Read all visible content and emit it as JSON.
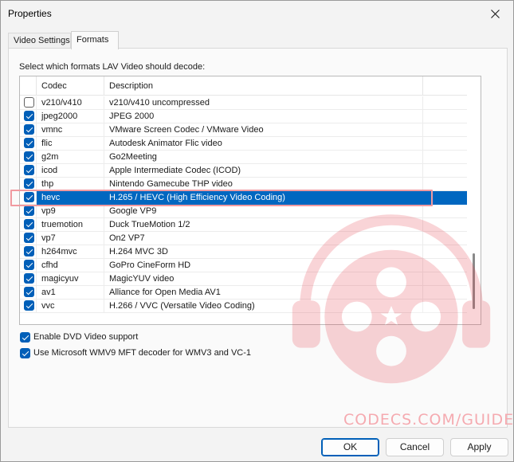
{
  "window": {
    "title": "Properties"
  },
  "tabs": [
    {
      "label": "Video Settings",
      "active": false
    },
    {
      "label": "Formats",
      "active": true
    }
  ],
  "formats": {
    "instruction": "Select which formats LAV Video should decode:",
    "columns": {
      "codec": "Codec",
      "description": "Description"
    },
    "rows": [
      {
        "codec": "v210/v410",
        "description": "v210/v410 uncompressed",
        "checked": false,
        "selected": false
      },
      {
        "codec": "jpeg2000",
        "description": "JPEG 2000",
        "checked": true,
        "selected": false
      },
      {
        "codec": "vmnc",
        "description": "VMware Screen Codec / VMware Video",
        "checked": true,
        "selected": false
      },
      {
        "codec": "flic",
        "description": "Autodesk Animator Flic video",
        "checked": true,
        "selected": false
      },
      {
        "codec": "g2m",
        "description": "Go2Meeting",
        "checked": true,
        "selected": false
      },
      {
        "codec": "icod",
        "description": "Apple Intermediate Codec (ICOD)",
        "checked": true,
        "selected": false
      },
      {
        "codec": "thp",
        "description": "Nintendo Gamecube THP video",
        "checked": true,
        "selected": false
      },
      {
        "codec": "hevc",
        "description": "H.265 / HEVC (High Efficiency Video Coding)",
        "checked": true,
        "selected": true
      },
      {
        "codec": "vp9",
        "description": "Google VP9",
        "checked": true,
        "selected": false
      },
      {
        "codec": "truemotion",
        "description": "Duck TrueMotion 1/2",
        "checked": true,
        "selected": false
      },
      {
        "codec": "vp7",
        "description": "On2 VP7",
        "checked": true,
        "selected": false
      },
      {
        "codec": "h264mvc",
        "description": "H.264 MVC 3D",
        "checked": true,
        "selected": false
      },
      {
        "codec": "cfhd",
        "description": "GoPro CineForm HD",
        "checked": true,
        "selected": false
      },
      {
        "codec": "magicyuv",
        "description": "MagicYUV video",
        "checked": true,
        "selected": false
      },
      {
        "codec": "av1",
        "description": "Alliance for Open Media AV1",
        "checked": true,
        "selected": false
      },
      {
        "codec": "vvc",
        "description": "H.266 / VVC (Versatile Video Coding)",
        "checked": true,
        "selected": false
      }
    ],
    "options": {
      "dvd": {
        "label": "Enable DVD Video support",
        "checked": true
      },
      "wmv": {
        "label": "Use Microsoft WMV9 MFT decoder for WMV3 and VC-1",
        "checked": true
      }
    }
  },
  "watermark": {
    "text": "CODECS.COM/GUIDES"
  },
  "buttons": {
    "ok": "OK",
    "cancel": "Cancel",
    "apply": "Apply"
  },
  "colors": {
    "selection": "#0067c0",
    "accent": "#005fb8",
    "highlight": "#f19aa0"
  }
}
